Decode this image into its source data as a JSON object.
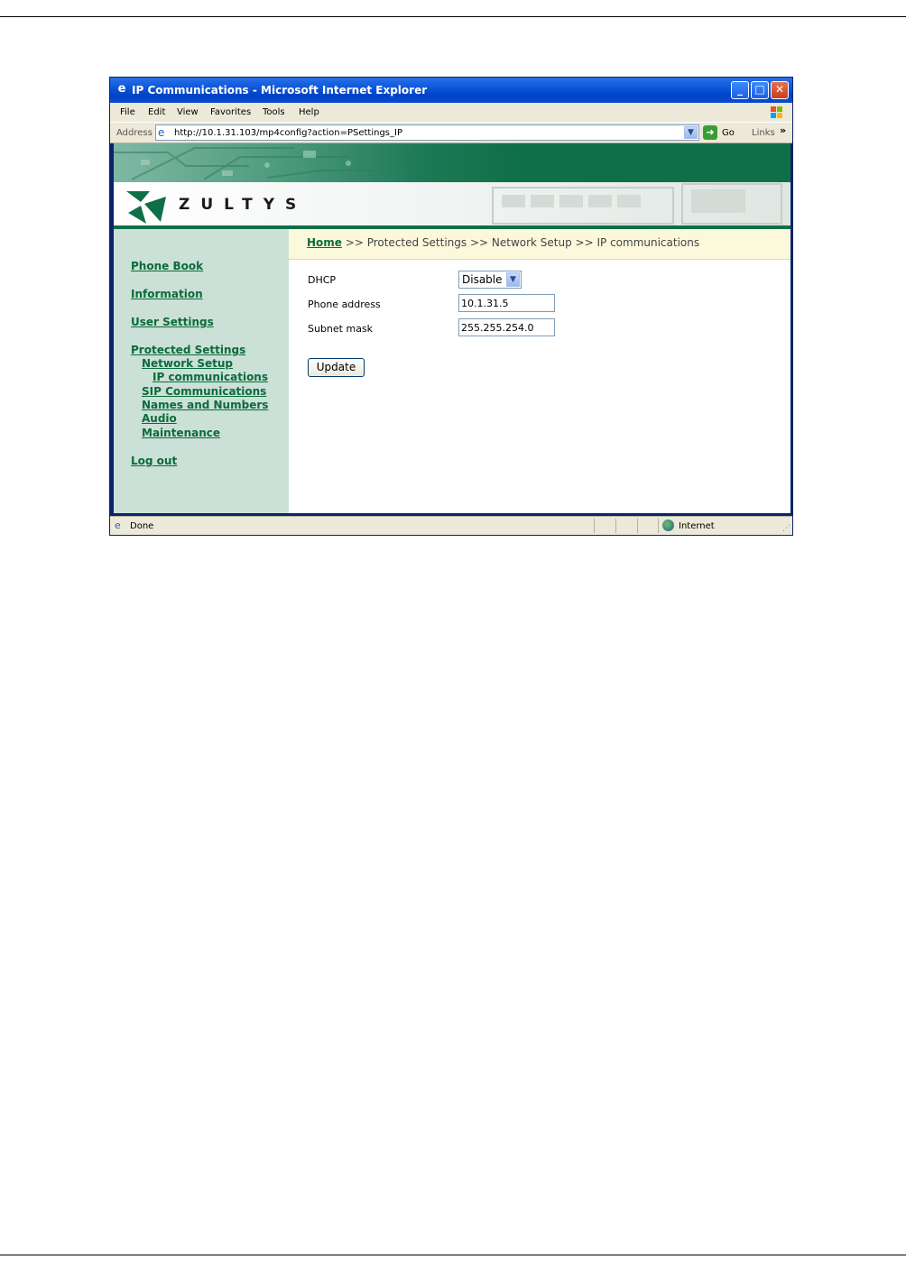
{
  "window": {
    "title": "IP Communications - Microsoft Internet Explorer",
    "controls": [
      "minimize",
      "maximize",
      "close"
    ]
  },
  "menubar": {
    "items": [
      "File",
      "Edit",
      "View",
      "Favorites",
      "Tools",
      "Help"
    ]
  },
  "addressbar": {
    "label": "Address",
    "url": "http://10.1.31.103/mp4config?action=PSettings_IP",
    "go_label": "Go",
    "links_label": "Links"
  },
  "brand": {
    "name": "ZULTYS"
  },
  "sidebar": {
    "items": [
      {
        "label": "Phone Book",
        "level": 0
      },
      {
        "label": "Information",
        "level": 0
      },
      {
        "label": "User Settings",
        "level": 0
      },
      {
        "label": "Protected Settings",
        "level": 0
      },
      {
        "label": "Network Setup",
        "level": 1
      },
      {
        "label": "IP communications",
        "level": 2
      },
      {
        "label": "SIP Communications",
        "level": 1
      },
      {
        "label": "Names and Numbers",
        "level": 1
      },
      {
        "label": "Audio",
        "level": 1
      },
      {
        "label": "Maintenance",
        "level": 1
      },
      {
        "label": "Log out",
        "level": 0
      }
    ]
  },
  "breadcrumb": {
    "home": "Home",
    "rest": ">> Protected Settings >> Network Setup >> IP communications"
  },
  "form": {
    "dhcp_label": "DHCP",
    "dhcp_value": "Disable",
    "phone_address_label": "Phone address",
    "phone_address_value": "10.1.31.5",
    "subnet_mask_label": "Subnet mask",
    "subnet_mask_value": "255.255.254.0",
    "update_label": "Update"
  },
  "statusbar": {
    "status": "Done",
    "zone": "Internet"
  },
  "colors": {
    "brand_green": "#0f6f47",
    "link_green": "#0b6b3a",
    "sidebar_bg": "#cbe0d7",
    "breadcrumb_bg": "#fbf8dc"
  }
}
